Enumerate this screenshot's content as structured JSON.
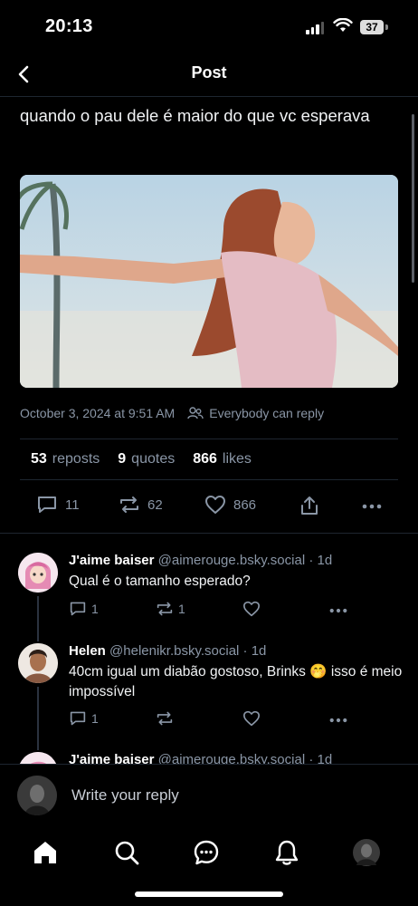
{
  "status": {
    "time": "20:13",
    "battery": "37"
  },
  "header": {
    "title": "Post"
  },
  "post": {
    "text": "quando o pau dele é maior do que vc esperava",
    "date": "October 3, 2024 at 9:51 AM",
    "reply_setting": "Everybody can reply",
    "stats": {
      "reposts_count": "53",
      "reposts_label": "reposts",
      "quotes_count": "9",
      "quotes_label": "quotes",
      "likes_count": "866",
      "likes_label": "likes"
    },
    "actions": {
      "replies": "11",
      "reposts": "62",
      "likes": "866"
    }
  },
  "replies": [
    {
      "name": "J'aime baiser",
      "handle": "@aimerouge.bsky.social",
      "time": "· 1d",
      "text": "Qual é o tamanho esperado?",
      "reply_count": "1",
      "repost_count": "1"
    },
    {
      "name": "Helen",
      "handle": "@helenikr.bsky.social",
      "time": "· 1d",
      "text": "40cm igual um diabão gostoso, Brinks 🤭 isso é meio impossível",
      "reply_count": "1",
      "repost_count": ""
    },
    {
      "name": "J'aime baiser",
      "handle": "@aimerouge.bsky.social",
      "time": "· 1d"
    }
  ],
  "reply_bar": {
    "placeholder": "Write your reply"
  },
  "icons": {
    "back": "chevron-left-icon",
    "globe": "people-icon",
    "reply": "speech-bubble-icon",
    "repost": "repost-icon",
    "like": "heart-icon",
    "share": "share-icon",
    "more": "ellipsis-icon",
    "home": "home-icon",
    "search": "search-icon",
    "chat": "chat-icon",
    "notifications": "bell-icon"
  },
  "colors": {
    "background": "#000000",
    "muted": "#8a96a6",
    "divider": "#1e2630"
  }
}
